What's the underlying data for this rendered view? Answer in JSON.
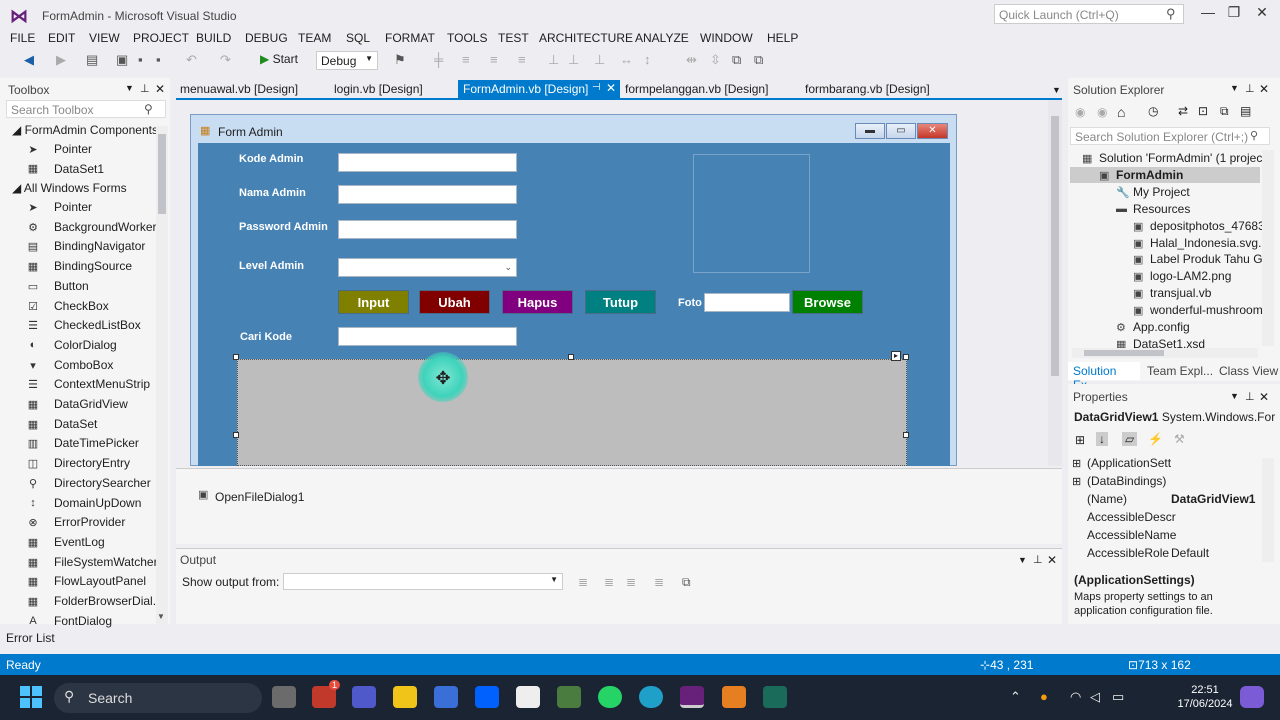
{
  "window": {
    "title": "FormAdmin - Microsoft Visual Studio",
    "quick_launch_placeholder": "Quick Launch (Ctrl+Q)"
  },
  "menu": [
    "FILE",
    "EDIT",
    "VIEW",
    "PROJECT",
    "BUILD",
    "DEBUG",
    "TEAM",
    "SQL",
    "FORMAT",
    "TOOLS",
    "TEST",
    "ARCHITECTURE",
    "ANALYZE",
    "WINDOW",
    "HELP"
  ],
  "toolbar": {
    "start_label": "Start",
    "config_value": "Debug"
  },
  "toolbox": {
    "title": "Toolbox",
    "search_placeholder": "Search Toolbox",
    "group1": "FormAdmin Components",
    "group1_items": [
      "Pointer",
      "DataSet1"
    ],
    "group2": "All Windows Forms",
    "group2_items": [
      "Pointer",
      "BackgroundWorker",
      "BindingNavigator",
      "BindingSource",
      "Button",
      "CheckBox",
      "CheckedListBox",
      "ColorDialog",
      "ComboBox",
      "ContextMenuStrip",
      "DataGridView",
      "DataSet",
      "DateTimePicker",
      "DirectoryEntry",
      "DirectorySearcher",
      "DomainUpDown",
      "ErrorProvider",
      "EventLog",
      "FileSystemWatcher",
      "FlowLayoutPanel",
      "FolderBrowserDial...",
      "FontDialog"
    ]
  },
  "tabs": [
    "menuawal.vb [Design]",
    "login.vb [Design]",
    "FormAdmin.vb [Design]",
    "formpelanggan.vb [Design]",
    "formbarang.vb [Design]"
  ],
  "form": {
    "title": "Form Admin",
    "labels": {
      "kode": "Kode Admin",
      "nama": "Nama Admin",
      "password": "Password Admin",
      "level": "Level Admin",
      "cari": "Cari Kode",
      "foto": "Foto"
    },
    "buttons": {
      "input": {
        "label": "Input",
        "color": "#808000"
      },
      "ubah": {
        "label": "Ubah",
        "color": "#800000"
      },
      "hapus": {
        "label": "Hapus",
        "color": "#800080"
      },
      "tutup": {
        "label": "Tutup",
        "color": "#008080"
      },
      "browse": {
        "label": "Browse",
        "color": "#008000"
      }
    },
    "background_color": "#4682b4"
  },
  "component_tray": {
    "item": "OpenFileDialog1"
  },
  "output": {
    "title": "Output",
    "show_from_label": "Show output from:"
  },
  "solution_explorer": {
    "title": "Solution Explorer",
    "search_placeholder": "Search Solution Explorer (Ctrl+;)",
    "items": [
      "Solution 'FormAdmin' (1 project",
      "FormAdmin",
      "My Project",
      "Resources",
      "depositphotos_476835",
      "Halal_Indonesia.svg.p",
      "Label Produk Tahu Go",
      "logo-LAM2.png",
      "transjual.vb",
      "wonderful-mushroom",
      "App.config",
      "DataSet1.xsd"
    ],
    "bottom_tabs": [
      "Solution Ex...",
      "Team Expl...",
      "Class View"
    ]
  },
  "properties": {
    "title": "Properties",
    "object": "DataGridView1",
    "object_type": "System.Windows.For",
    "rows": [
      {
        "name": "(ApplicationSett",
        "value": ""
      },
      {
        "name": "(DataBindings)",
        "value": ""
      },
      {
        "name": "(Name)",
        "value": "DataGridView1"
      },
      {
        "name": "AccessibleDescr",
        "value": ""
      },
      {
        "name": "AccessibleName",
        "value": ""
      },
      {
        "name": "AccessibleRole",
        "value": "Default"
      }
    ],
    "desc_title": "(ApplicationSettings)",
    "desc_text": "Maps property settings to an application configuration file."
  },
  "error_list_label": "Error List",
  "status": {
    "text": "Ready",
    "position": "43 , 231",
    "size": "713 x 162"
  },
  "taskbar": {
    "search_label": "Search",
    "time": "22:51",
    "date": "17/06/2024",
    "notification_count": "1"
  },
  "accent_color": "#007acc"
}
